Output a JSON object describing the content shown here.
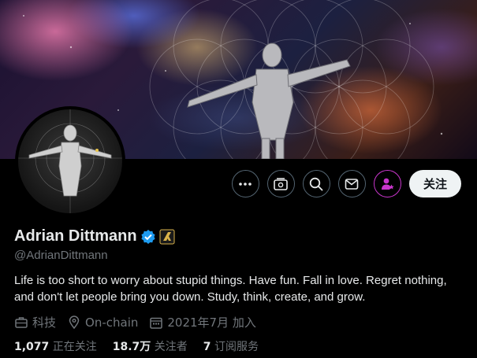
{
  "profile": {
    "name": "Adrian Dittmann",
    "handle": "@AdrianDittmann",
    "bio": "Life is too short to worry about stupid things. Have fun. Fall in love. Regret nothing, and don't let people bring you down. Study, think, create, and grow.",
    "verified_color": "#1d9bf0"
  },
  "actions": {
    "more": "more-icon",
    "subscriptions": "subscriptions-icon",
    "search": "search-icon",
    "message": "message-icon",
    "subscribe": "subscribe-icon",
    "follow_label": "关注"
  },
  "meta": {
    "category": "科技",
    "location": "On-chain",
    "joined": "2021年7月 加入"
  },
  "stats": {
    "following_count": "1,077",
    "following_label": "正在关注",
    "followers_count": "18.7万",
    "followers_label": "关注者",
    "subscriptions_count": "7",
    "subscriptions_label": "订阅服务"
  },
  "colors": {
    "accent": "#c936cc",
    "muted": "#71767b",
    "text": "#e7e9ea"
  }
}
